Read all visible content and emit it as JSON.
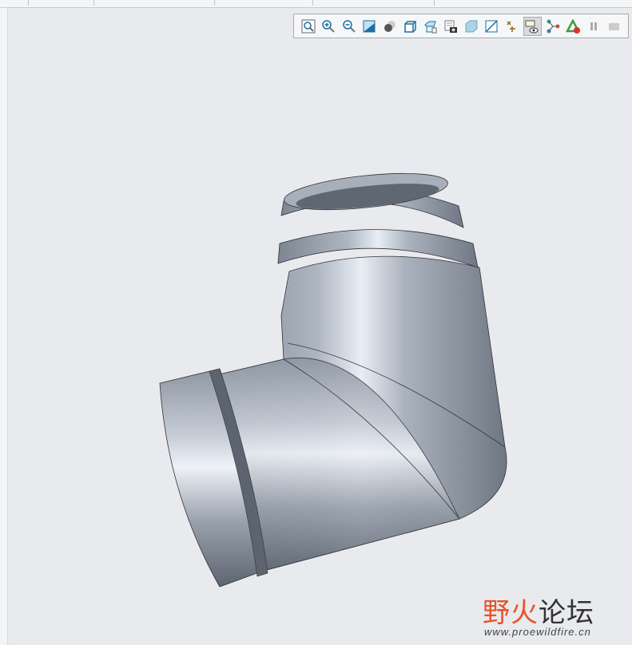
{
  "toolbar": {
    "buttons": [
      {
        "icon": "refit-icon",
        "active": false
      },
      {
        "icon": "zoom-in-icon",
        "active": false
      },
      {
        "icon": "zoom-out-icon",
        "active": false
      },
      {
        "icon": "repaint-icon",
        "active": false
      },
      {
        "icon": "display-style-icon",
        "active": false
      },
      {
        "icon": "saved-orientations-icon",
        "active": false
      },
      {
        "icon": "view-manager-icon",
        "active": false
      },
      {
        "icon": "perspective-view-icon",
        "active": false
      },
      {
        "icon": "section-icon",
        "active": false
      },
      {
        "icon": "datum-display-icon",
        "active": false
      },
      {
        "icon": "annotation-display-icon",
        "active": false
      },
      {
        "icon": "spin-center-icon",
        "active": true
      },
      {
        "icon": "connections-icon",
        "active": false
      },
      {
        "icon": "appearance-icon",
        "active": false
      },
      {
        "icon": "pause-icon",
        "active": false
      },
      {
        "icon": "disabled-icon",
        "active": false
      }
    ]
  },
  "colors": {
    "background": "#e8eaed",
    "model": "#9ea6b2",
    "accent": "#1a6fa0"
  },
  "watermark": {
    "text_cn_1": "野",
    "text_cn_2": "火",
    "text_cn_3": "论坛",
    "url": "www.proewildfire.cn"
  }
}
